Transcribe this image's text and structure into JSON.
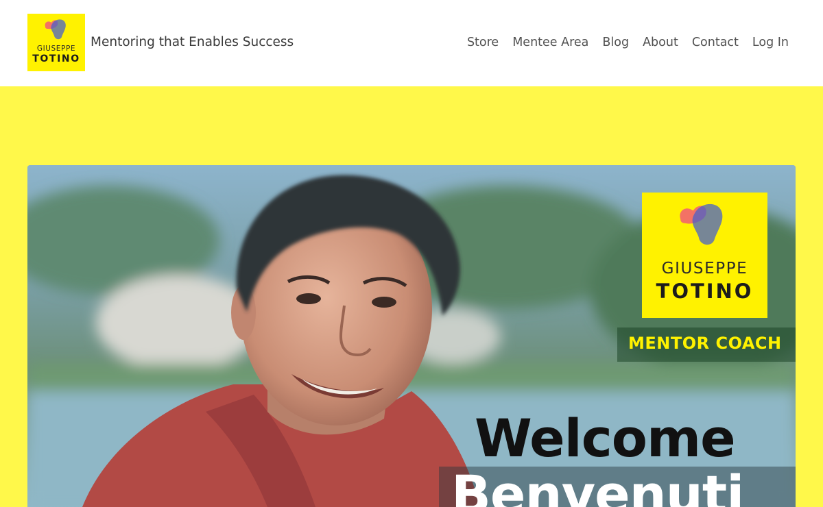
{
  "header": {
    "logo": {
      "first_name": "GIUSEPPE",
      "last_name": "TOTINO",
      "icon": "colorful-blob-icon"
    },
    "tagline": "Mentoring that Enables Success",
    "nav": [
      {
        "label": "Store"
      },
      {
        "label": "Mentee Area"
      },
      {
        "label": "Blog"
      },
      {
        "label": "About"
      },
      {
        "label": "Contact"
      },
      {
        "label": "Log In"
      }
    ]
  },
  "hero": {
    "badge": {
      "first_name": "GIUSEPPE",
      "last_name": "TOTINO",
      "icon": "colorful-blob-icon"
    },
    "role": "MENTOR COACH",
    "headline": "Welcome",
    "headline_2": "Benvenuti"
  },
  "colors": {
    "section_background": "#fff84a",
    "brand_yellow": "#fff200",
    "nav_text": "#505050"
  }
}
